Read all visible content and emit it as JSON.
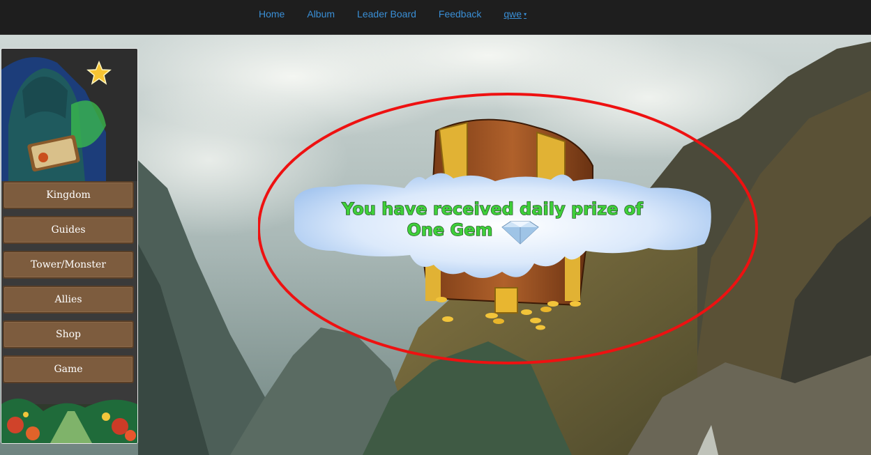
{
  "nav": {
    "items": [
      {
        "label": "Home"
      },
      {
        "label": "Album"
      },
      {
        "label": "Leader Board"
      },
      {
        "label": "Feedback"
      }
    ],
    "user": {
      "label": "qwe",
      "caret": "▾"
    }
  },
  "sidebar": {
    "star_icon": "star-icon",
    "items": [
      {
        "label": "Kingdom"
      },
      {
        "label": "Guides"
      },
      {
        "label": "Tower/Monster"
      },
      {
        "label": "Allies"
      },
      {
        "label": "Shop"
      },
      {
        "label": "Game"
      }
    ]
  },
  "prize": {
    "line1": "You have received daily prize of",
    "line2": "One Gem",
    "highlight_color": "#ee1111"
  }
}
